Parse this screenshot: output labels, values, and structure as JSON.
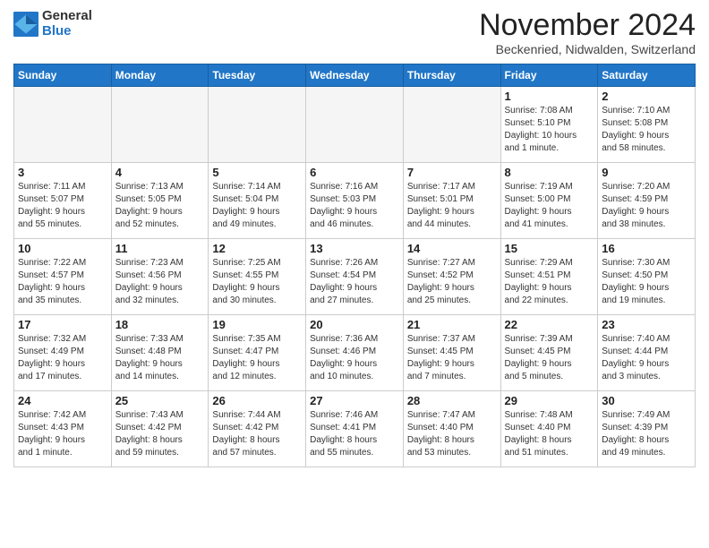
{
  "header": {
    "logo_general": "General",
    "logo_blue": "Blue",
    "month_title": "November 2024",
    "location": "Beckenried, Nidwalden, Switzerland"
  },
  "weekdays": [
    "Sunday",
    "Monday",
    "Tuesday",
    "Wednesday",
    "Thursday",
    "Friday",
    "Saturday"
  ],
  "weeks": [
    [
      {
        "day": "",
        "info": ""
      },
      {
        "day": "",
        "info": ""
      },
      {
        "day": "",
        "info": ""
      },
      {
        "day": "",
        "info": ""
      },
      {
        "day": "",
        "info": ""
      },
      {
        "day": "1",
        "info": "Sunrise: 7:08 AM\nSunset: 5:10 PM\nDaylight: 10 hours\nand 1 minute."
      },
      {
        "day": "2",
        "info": "Sunrise: 7:10 AM\nSunset: 5:08 PM\nDaylight: 9 hours\nand 58 minutes."
      }
    ],
    [
      {
        "day": "3",
        "info": "Sunrise: 7:11 AM\nSunset: 5:07 PM\nDaylight: 9 hours\nand 55 minutes."
      },
      {
        "day": "4",
        "info": "Sunrise: 7:13 AM\nSunset: 5:05 PM\nDaylight: 9 hours\nand 52 minutes."
      },
      {
        "day": "5",
        "info": "Sunrise: 7:14 AM\nSunset: 5:04 PM\nDaylight: 9 hours\nand 49 minutes."
      },
      {
        "day": "6",
        "info": "Sunrise: 7:16 AM\nSunset: 5:03 PM\nDaylight: 9 hours\nand 46 minutes."
      },
      {
        "day": "7",
        "info": "Sunrise: 7:17 AM\nSunset: 5:01 PM\nDaylight: 9 hours\nand 44 minutes."
      },
      {
        "day": "8",
        "info": "Sunrise: 7:19 AM\nSunset: 5:00 PM\nDaylight: 9 hours\nand 41 minutes."
      },
      {
        "day": "9",
        "info": "Sunrise: 7:20 AM\nSunset: 4:59 PM\nDaylight: 9 hours\nand 38 minutes."
      }
    ],
    [
      {
        "day": "10",
        "info": "Sunrise: 7:22 AM\nSunset: 4:57 PM\nDaylight: 9 hours\nand 35 minutes."
      },
      {
        "day": "11",
        "info": "Sunrise: 7:23 AM\nSunset: 4:56 PM\nDaylight: 9 hours\nand 32 minutes."
      },
      {
        "day": "12",
        "info": "Sunrise: 7:25 AM\nSunset: 4:55 PM\nDaylight: 9 hours\nand 30 minutes."
      },
      {
        "day": "13",
        "info": "Sunrise: 7:26 AM\nSunset: 4:54 PM\nDaylight: 9 hours\nand 27 minutes."
      },
      {
        "day": "14",
        "info": "Sunrise: 7:27 AM\nSunset: 4:52 PM\nDaylight: 9 hours\nand 25 minutes."
      },
      {
        "day": "15",
        "info": "Sunrise: 7:29 AM\nSunset: 4:51 PM\nDaylight: 9 hours\nand 22 minutes."
      },
      {
        "day": "16",
        "info": "Sunrise: 7:30 AM\nSunset: 4:50 PM\nDaylight: 9 hours\nand 19 minutes."
      }
    ],
    [
      {
        "day": "17",
        "info": "Sunrise: 7:32 AM\nSunset: 4:49 PM\nDaylight: 9 hours\nand 17 minutes."
      },
      {
        "day": "18",
        "info": "Sunrise: 7:33 AM\nSunset: 4:48 PM\nDaylight: 9 hours\nand 14 minutes."
      },
      {
        "day": "19",
        "info": "Sunrise: 7:35 AM\nSunset: 4:47 PM\nDaylight: 9 hours\nand 12 minutes."
      },
      {
        "day": "20",
        "info": "Sunrise: 7:36 AM\nSunset: 4:46 PM\nDaylight: 9 hours\nand 10 minutes."
      },
      {
        "day": "21",
        "info": "Sunrise: 7:37 AM\nSunset: 4:45 PM\nDaylight: 9 hours\nand 7 minutes."
      },
      {
        "day": "22",
        "info": "Sunrise: 7:39 AM\nSunset: 4:45 PM\nDaylight: 9 hours\nand 5 minutes."
      },
      {
        "day": "23",
        "info": "Sunrise: 7:40 AM\nSunset: 4:44 PM\nDaylight: 9 hours\nand 3 minutes."
      }
    ],
    [
      {
        "day": "24",
        "info": "Sunrise: 7:42 AM\nSunset: 4:43 PM\nDaylight: 9 hours\nand 1 minute."
      },
      {
        "day": "25",
        "info": "Sunrise: 7:43 AM\nSunset: 4:42 PM\nDaylight: 8 hours\nand 59 minutes."
      },
      {
        "day": "26",
        "info": "Sunrise: 7:44 AM\nSunset: 4:42 PM\nDaylight: 8 hours\nand 57 minutes."
      },
      {
        "day": "27",
        "info": "Sunrise: 7:46 AM\nSunset: 4:41 PM\nDaylight: 8 hours\nand 55 minutes."
      },
      {
        "day": "28",
        "info": "Sunrise: 7:47 AM\nSunset: 4:40 PM\nDaylight: 8 hours\nand 53 minutes."
      },
      {
        "day": "29",
        "info": "Sunrise: 7:48 AM\nSunset: 4:40 PM\nDaylight: 8 hours\nand 51 minutes."
      },
      {
        "day": "30",
        "info": "Sunrise: 7:49 AM\nSunset: 4:39 PM\nDaylight: 8 hours\nand 49 minutes."
      }
    ]
  ]
}
